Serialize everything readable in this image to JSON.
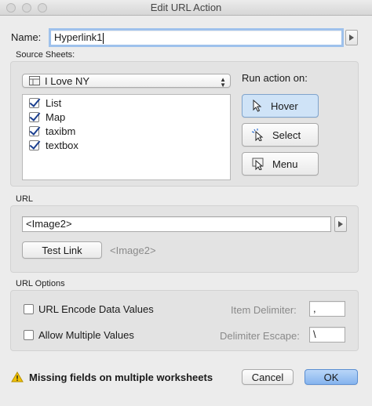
{
  "window": {
    "title": "Edit URL Action"
  },
  "name": {
    "label": "Name:",
    "value": "Hyperlink1"
  },
  "source_sheets": {
    "label": "Source Sheets:",
    "selected": "I Love NY",
    "sheets": [
      {
        "label": "List",
        "checked": true
      },
      {
        "label": "Map",
        "checked": true
      },
      {
        "label": "taxibm",
        "checked": true
      },
      {
        "label": "textbox",
        "checked": true
      }
    ]
  },
  "run_action": {
    "label": "Run action on:",
    "hover": "Hover",
    "select": "Select",
    "menu": "Menu",
    "active": "Hover"
  },
  "url": {
    "label": "URL",
    "value": "<Image2>",
    "test_button": "Test Link",
    "preview": "<Image2>"
  },
  "url_options": {
    "label": "URL Options",
    "encode": "URL Encode Data Values",
    "allow_multiple": "Allow Multiple Values",
    "item_delimiter_label": "Item Delimiter:",
    "item_delimiter_value": ",",
    "delimiter_escape_label": "Delimiter Escape:",
    "delimiter_escape_value": "\\"
  },
  "footer": {
    "warning": "Missing fields on multiple worksheets",
    "cancel": "Cancel",
    "ok": "OK"
  },
  "colors": {
    "accent": "#86b4ee",
    "pressed": "#cfe3f7",
    "warning": "#f2c200"
  }
}
